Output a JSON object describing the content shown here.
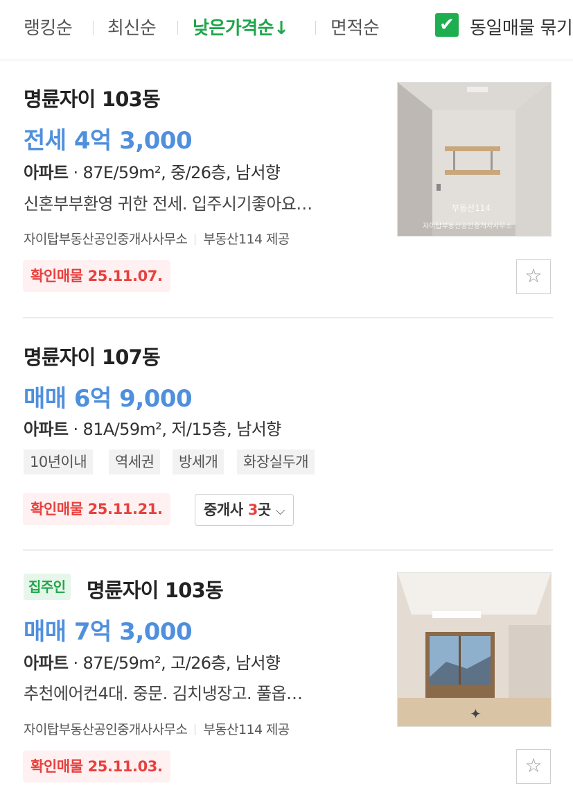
{
  "sort_bar": {
    "items": [
      {
        "label": "랭킹순",
        "active": false
      },
      {
        "label": "최신순",
        "active": false
      },
      {
        "label": "낮은가격순↓",
        "active": true
      },
      {
        "label": "면적순",
        "active": false
      }
    ],
    "group_same_listings": {
      "label": "동일매물 묶기",
      "checked": true
    }
  },
  "listings": [
    {
      "title": "명륜자이 103동",
      "price": "전세 4억 3,000",
      "property_type": "아파트",
      "spec": "· 87E/59m², 중/26층, 남서향",
      "description": "신혼부부환영 귀한 전세. 입주시기좋아요…",
      "agency": "자이탑부동산공인중개사사무소",
      "provider": "부동산114 제공",
      "confirmed": "확인매물 25.11.07.",
      "thumbnail_watermark_logo": "부동산114",
      "thumbnail_watermark_text": "자이탑부동산공인중개사사무소",
      "favorite_icon": "star-outline"
    },
    {
      "title": "명륜자이 107동",
      "price": "매매 6억 9,000",
      "property_type": "아파트",
      "spec": "· 81A/59m², 저/15층, 남서향",
      "tags": [
        "10년이내",
        "역세권",
        "방세개",
        "화장실두개"
      ],
      "confirmed": "확인매물 25.11.21.",
      "brokers_label": "중개사",
      "brokers_count": "3",
      "brokers_unit": "곳",
      "brokers_icon": "chevron-down"
    },
    {
      "owner_badge": "집주인",
      "title": "명륜자이 103동",
      "price": "매매 7억 3,000",
      "property_type": "아파트",
      "spec": "· 87E/59m², 고/26층, 남서향",
      "description": "추천에어컨4대. 중문. 김치냉장고. 풀옵…",
      "agency": "자이탑부동산공인중개사사무소",
      "provider": "부동산114 제공",
      "confirmed": "확인매물 25.11.03.",
      "favorite_icon": "star-outline"
    }
  ]
}
